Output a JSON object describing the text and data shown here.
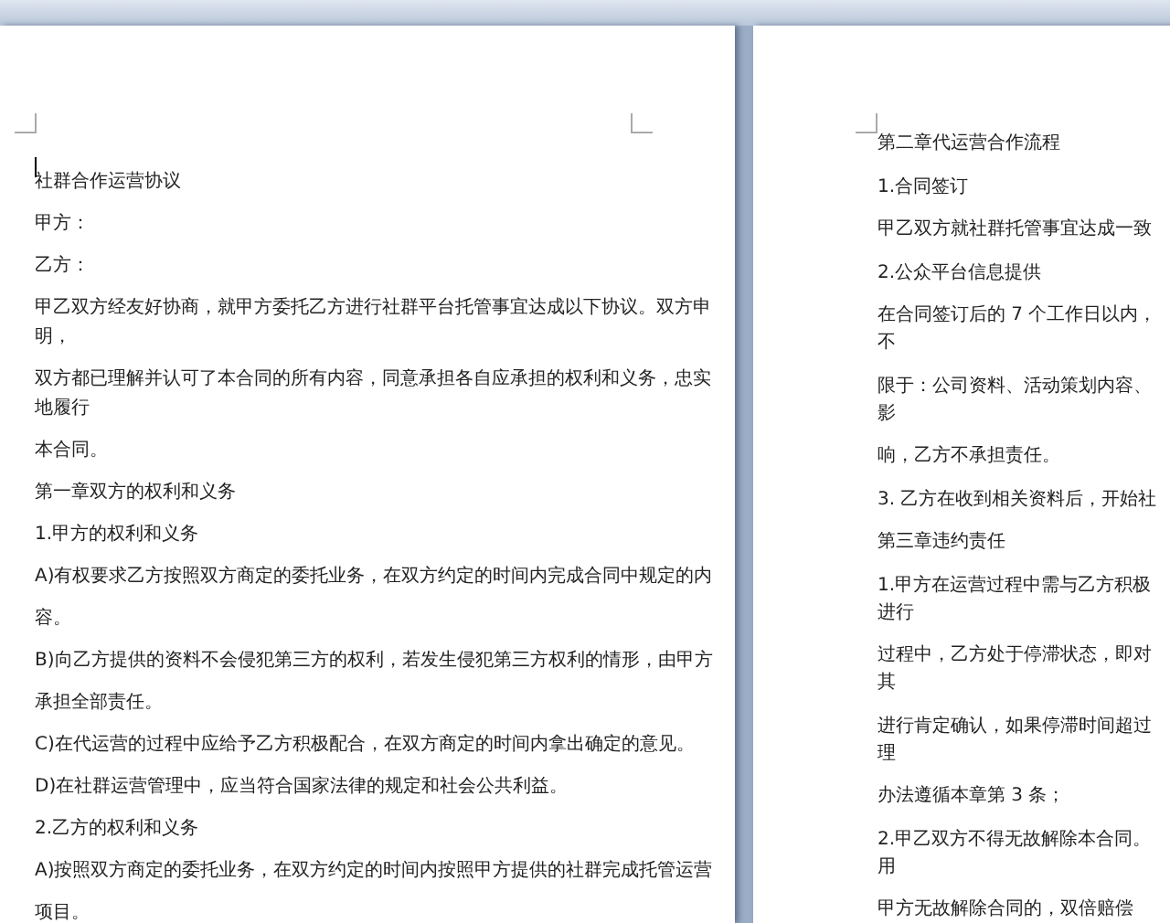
{
  "pages": [
    {
      "caret": true,
      "paragraphs": [
        {
          "lines": [
            "社群合作运营协议"
          ]
        },
        {
          "lines": [
            "甲方："
          ]
        },
        {
          "lines": [
            "乙方："
          ]
        },
        {
          "lines": [
            "甲乙双方经友好协商，就甲方委托乙方进行社群平台托管事宜达成以下协议。双方申",
            "明，"
          ]
        },
        {
          "lines": [
            "双方都已理解并认可了本合同的所有内容，同意承担各自应承担的权利和义务，忠实",
            "地履行"
          ]
        },
        {
          "lines": [
            "本合同。"
          ]
        },
        {
          "lines": [
            "第一章双方的权利和义务"
          ]
        },
        {
          "lines": [
            "1.甲方的权利和义务"
          ]
        },
        {
          "lines": [
            "A)有权要求乙方按照双方商定的委托业务，在双方约定的时间内完成合同中规定的内"
          ]
        },
        {
          "lines": [
            "容。"
          ]
        },
        {
          "lines": [
            "B)向乙方提供的资料不会侵犯第三方的权利，若发生侵犯第三方权利的情形，由甲方"
          ]
        },
        {
          "lines": [
            "承担全部责任。"
          ]
        },
        {
          "lines": [
            "C)在代运营的过程中应给予乙方积极配合，在双方商定的时间内拿出确定的意见。"
          ]
        },
        {
          "lines": [
            "D)在社群运营管理中，应当符合国家法律的规定和社会公共利益。"
          ]
        },
        {
          "lines": [
            "2.乙方的权利和义务"
          ]
        },
        {
          "lines": [
            "A)按照双方商定的委托业务，在双方约定的时间内按照甲方提供的社群完成托管运营"
          ]
        },
        {
          "lines": [
            "项目。"
          ]
        }
      ]
    },
    {
      "paragraphs": [
        {
          "lines": [
            "第二章代运营合作流程"
          ]
        },
        {
          "lines": [
            "1.合同签订"
          ]
        },
        {
          "lines": [
            "甲乙双方就社群托管事宜达成一致"
          ]
        },
        {
          "lines": [
            "2.公众平台信息提供"
          ]
        },
        {
          "lines": [
            "在合同签订后的 7 个工作日以内，",
            "不"
          ]
        },
        {
          "lines": [
            "限于：公司资料、活动策划内容、",
            "影"
          ]
        },
        {
          "lines": [
            "响，乙方不承担责任。"
          ]
        },
        {
          "lines": [
            "3. 乙方在收到相关资料后，开始社"
          ]
        },
        {
          "lines": [
            "第三章违约责任"
          ]
        },
        {
          "lines": [
            "1.甲方在运营过程中需与乙方积极",
            "进行"
          ]
        },
        {
          "lines": [
            "过程中，乙方处于停滞状态，即对",
            "其"
          ]
        },
        {
          "lines": [
            "进行肯定确认，如果停滞时间超过",
            "理"
          ]
        },
        {
          "lines": [
            "办法遵循本章第 3 条；"
          ]
        },
        {
          "lines": [
            "2.甲乙双方不得无故解除本合同。",
            "用"
          ]
        },
        {
          "lines": [
            "甲方无故解除合同的，双倍赔偿"
          ]
        }
      ]
    }
  ]
}
